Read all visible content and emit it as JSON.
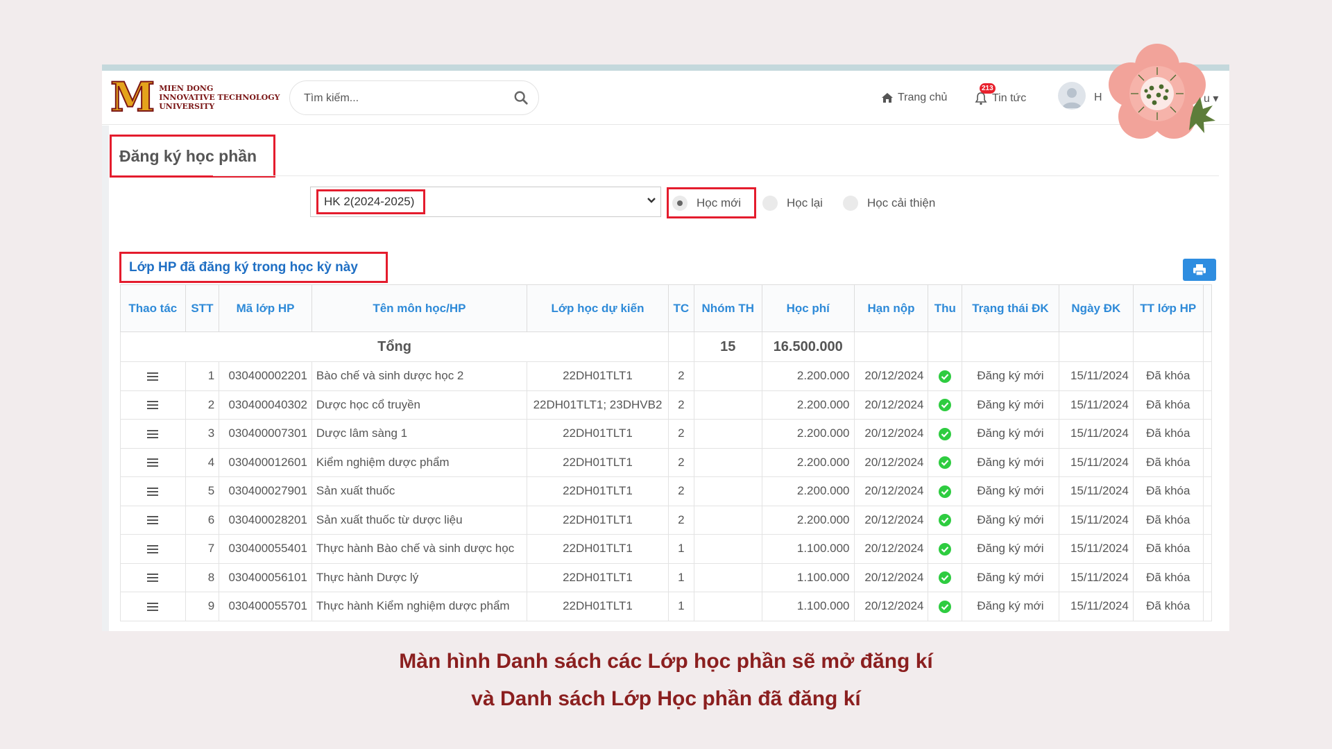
{
  "brand": {
    "logo_letter": "M",
    "logo_line1": "MIEN DONG",
    "logo_line2": "INNOVATIVE TECHNOLOGY",
    "logo_line3": "UNIVERSITY"
  },
  "header": {
    "search_placeholder": "Tìm kiếm...",
    "home_label": "Trang chủ",
    "news_label": "Tin tức",
    "news_badge": "213",
    "user_label_start": "H",
    "user_label_end": "u"
  },
  "page": {
    "title": "Đăng ký học phần",
    "semester_selected": "HK 2(2024-2025)",
    "radios": [
      {
        "label": "Học mới",
        "checked": true
      },
      {
        "label": "Học lại",
        "checked": false
      },
      {
        "label": "Học cải thiện",
        "checked": false
      }
    ],
    "section_title": "Lớp HP đã đăng ký trong học kỳ này"
  },
  "table": {
    "columns": [
      "Thao tác",
      "STT",
      "Mã lớp HP",
      "Tên môn học/HP",
      "Lớp học dự kiến",
      "TC",
      "Nhóm TH",
      "Học phí",
      "Hạn nộp",
      "Thu",
      "Trạng thái ĐK",
      "Ngày ĐK",
      "TT lớp HP"
    ],
    "total_label": "Tổng",
    "total_credits": "15",
    "total_fee": "16.500.000",
    "rows": [
      {
        "stt": "1",
        "ma": "030400002201",
        "ten": "Bào chế và sinh dược học 2",
        "lop": "22DH01TLT1",
        "tc": "2",
        "nhom": "",
        "phi": "2.200.000",
        "han": "20/12/2024",
        "thu": true,
        "trangthai": "Đăng ký mới",
        "ngay": "15/11/2024",
        "tt": "Đã khóa"
      },
      {
        "stt": "2",
        "ma": "030400040302",
        "ten": "Dược học cổ truyền",
        "lop": "22DH01TLT1; 23DHVB2",
        "tc": "2",
        "nhom": "",
        "phi": "2.200.000",
        "han": "20/12/2024",
        "thu": true,
        "trangthai": "Đăng ký mới",
        "ngay": "15/11/2024",
        "tt": "Đã khóa"
      },
      {
        "stt": "3",
        "ma": "030400007301",
        "ten": "Dược lâm sàng 1",
        "lop": "22DH01TLT1",
        "tc": "2",
        "nhom": "",
        "phi": "2.200.000",
        "han": "20/12/2024",
        "thu": true,
        "trangthai": "Đăng ký mới",
        "ngay": "15/11/2024",
        "tt": "Đã khóa"
      },
      {
        "stt": "4",
        "ma": "030400012601",
        "ten": "Kiểm nghiệm dược phẩm",
        "lop": "22DH01TLT1",
        "tc": "2",
        "nhom": "",
        "phi": "2.200.000",
        "han": "20/12/2024",
        "thu": true,
        "trangthai": "Đăng ký mới",
        "ngay": "15/11/2024",
        "tt": "Đã khóa"
      },
      {
        "stt": "5",
        "ma": "030400027901",
        "ten": "Sản xuất thuốc",
        "lop": "22DH01TLT1",
        "tc": "2",
        "nhom": "",
        "phi": "2.200.000",
        "han": "20/12/2024",
        "thu": true,
        "trangthai": "Đăng ký mới",
        "ngay": "15/11/2024",
        "tt": "Đã khóa"
      },
      {
        "stt": "6",
        "ma": "030400028201",
        "ten": "Sản xuất thuốc từ dược liệu",
        "lop": "22DH01TLT1",
        "tc": "2",
        "nhom": "",
        "phi": "2.200.000",
        "han": "20/12/2024",
        "thu": true,
        "trangthai": "Đăng ký mới",
        "ngay": "15/11/2024",
        "tt": "Đã khóa"
      },
      {
        "stt": "7",
        "ma": "030400055401",
        "ten": "Thực hành Bào chế và sinh dược học",
        "lop": "22DH01TLT1",
        "tc": "1",
        "nhom": "",
        "phi": "1.100.000",
        "han": "20/12/2024",
        "thu": true,
        "trangthai": "Đăng ký mới",
        "ngay": "15/11/2024",
        "tt": "Đã khóa"
      },
      {
        "stt": "8",
        "ma": "030400056101",
        "ten": "Thực hành Dược lý",
        "lop": "22DH01TLT1",
        "tc": "1",
        "nhom": "",
        "phi": "1.100.000",
        "han": "20/12/2024",
        "thu": true,
        "trangthai": "Đăng ký mới",
        "ngay": "15/11/2024",
        "tt": "Đã khóa"
      },
      {
        "stt": "9",
        "ma": "030400055701",
        "ten": "Thực hành Kiểm nghiệm dược phẩm",
        "lop": "22DH01TLT1",
        "tc": "1",
        "nhom": "",
        "phi": "1.100.000",
        "han": "20/12/2024",
        "thu": true,
        "trangthai": "Đăng ký mới",
        "ngay": "15/11/2024",
        "tt": "Đã khóa"
      }
    ]
  },
  "caption": {
    "line1": "Màn hình Danh sách các Lớp học phần sẽ mở đăng kí",
    "line2": "và Danh sách Lớp Học phần đã đăng kí"
  },
  "icons": {
    "search": "search-icon",
    "home": "home-icon",
    "bell": "bell-icon",
    "print": "print-icon",
    "row_menu": "menu-icon",
    "paid": "check-circle-icon"
  },
  "colors": {
    "highlight": "#e41c2d",
    "header_text": "#2e8ad8",
    "print_button": "#2e8de0",
    "paid_check": "#2ecc40",
    "caption": "#8b1f1f"
  }
}
